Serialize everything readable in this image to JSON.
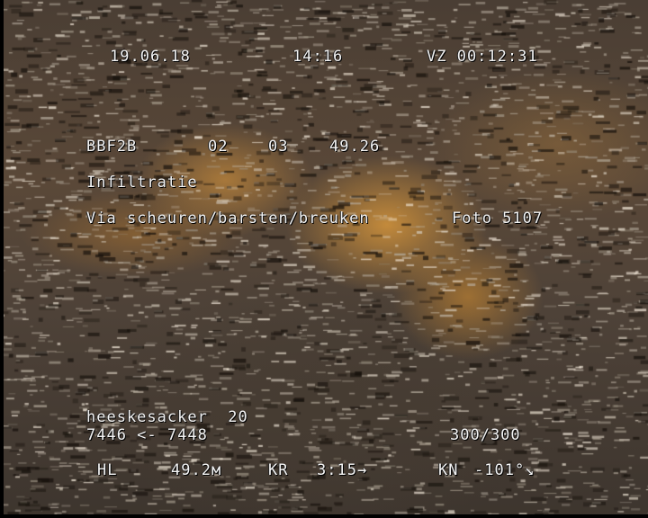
{
  "header": {
    "date": "19.06.18",
    "time": "14:16",
    "counter": "VZ 00:12:31"
  },
  "observation": {
    "code": "BBF2B",
    "q1": "02",
    "q2": "03",
    "distance": "49.26",
    "title": "Infiltratie",
    "detail": "Via scheuren/barsten/breuken",
    "photo": "Foto 5107"
  },
  "location": {
    "street": "heeskesacker  20",
    "section": "7446 <- 7448",
    "dimension": "300/300"
  },
  "footer": {
    "hl_label": "HL",
    "hl_value": "49.2м",
    "kr_label": "KR",
    "kr_value": "3:15→",
    "kn_label": "KN",
    "kn_value": "-101°↘"
  }
}
